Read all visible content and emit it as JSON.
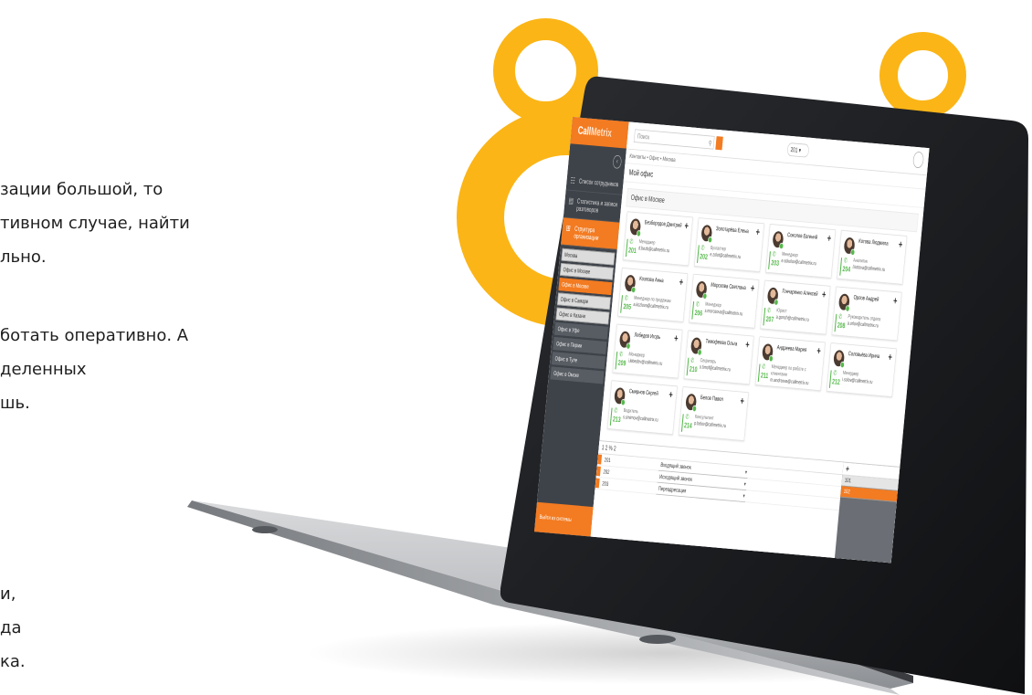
{
  "marketing_text": {
    "lines": [
      "зации большой, то",
      "тивном случае, найти",
      "льно.",
      "ботать оперативно. А",
      "деленных",
      "шь.",
      "и,",
      "да",
      "ка."
    ]
  },
  "colors": {
    "accent": "#f37b21",
    "ring": "#fbb517",
    "sidebar": "#3e434a",
    "online": "#56b94c"
  },
  "app": {
    "logo_prefix": "Call",
    "logo_suffix": "Metrix",
    "search_placeholder": "Поиск",
    "status_value": "201",
    "breadcrumb": "Контакты • Офис • Москва",
    "section_title": "Мой офис",
    "group_title": "Офис в Москве",
    "sidebar": {
      "items": [
        {
          "icon": "users-icon",
          "label": "Список сотрудников"
        },
        {
          "icon": "chart-icon",
          "label": "Статистика и записи разговоров"
        },
        {
          "icon": "org-icon",
          "label": "Структура организации"
        }
      ],
      "tree": [
        {
          "label": "Москва",
          "style": ""
        },
        {
          "label": "Офис в Москве",
          "style": ""
        },
        {
          "label": "Офис в Москве",
          "style": "active"
        },
        {
          "label": "Офис в Самаре",
          "style": ""
        },
        {
          "label": "Офис в Казани",
          "style": ""
        },
        {
          "label": "Офис в Уфе",
          "style": "dark"
        },
        {
          "label": "Офис в Перми",
          "style": "dark"
        },
        {
          "label": "Офис в Туле",
          "style": "dark"
        },
        {
          "label": "Офис в Омске",
          "style": "dark"
        }
      ],
      "footer": "Выйти из системы"
    },
    "contacts": [
      {
        "name": "Безбородов Дмитрий",
        "ext": "201",
        "role": "Менеджер",
        "mail": "d.bezb@callmetrix.ru"
      },
      {
        "name": "Золотарёва Елена",
        "ext": "202",
        "role": "Бухгалтер",
        "mail": "e.zolot@callmetrix.ru"
      },
      {
        "name": "Соколов Евгений",
        "ext": "203",
        "role": "Менеджер",
        "mail": "e.sokolov@callmetrix.ru"
      },
      {
        "name": "Котова Людмила",
        "ext": "204",
        "role": "Аналитик",
        "mail": "l.kotova@callmetrix.ru"
      },
      {
        "name": "Козлова Анна",
        "ext": "205",
        "role": "Менеджер по продажам",
        "mail": "a.kozlova@callmetrix.ru"
      },
      {
        "name": "Морозова Светлана",
        "ext": "206",
        "role": "Менеджер",
        "mail": "s.morozova@callmetrix.ru"
      },
      {
        "name": "Гончаренко Алексей",
        "ext": "207",
        "role": "Юрист",
        "mail": "a.gonch@callmetrix.ru"
      },
      {
        "name": "Орлов Андрей",
        "ext": "208",
        "role": "Руководитель отдела",
        "mail": "a.orlov@callmetrix.ru"
      },
      {
        "name": "Лебедев Игорь",
        "ext": "209",
        "role": "Менеджер",
        "mail": "i.lebedev@callmetrix.ru"
      },
      {
        "name": "Тимофеева Ольга",
        "ext": "210",
        "role": "Секретарь",
        "mail": "o.timof@callmetrix.ru"
      },
      {
        "name": "Андреева Мария",
        "ext": "211",
        "role": "Менеджер по работе с клиентами",
        "mail": "m.andreeva@callmetrix.ru"
      },
      {
        "name": "Соловьёва Ирина",
        "ext": "212",
        "role": "Менеджер",
        "mail": "i.solov@callmetrix.ru"
      },
      {
        "name": "Смирнов Сергей",
        "ext": "213",
        "role": "Водитель",
        "mail": "s.smirnov@callmetrix.ru"
      },
      {
        "name": "Белов Павел",
        "ext": "214",
        "role": "Консультант",
        "mail": "p.belov@callmetrix.ru"
      }
    ],
    "calls": {
      "head": "1 2 % 2",
      "rows": [
        {
          "num": "201",
          "route": "Входящий звонок"
        },
        {
          "num": "202",
          "route": "Исходящий звонок"
        },
        {
          "num": "203",
          "route": "Переадресация"
        }
      ]
    },
    "queue": [
      "101",
      "102"
    ]
  }
}
